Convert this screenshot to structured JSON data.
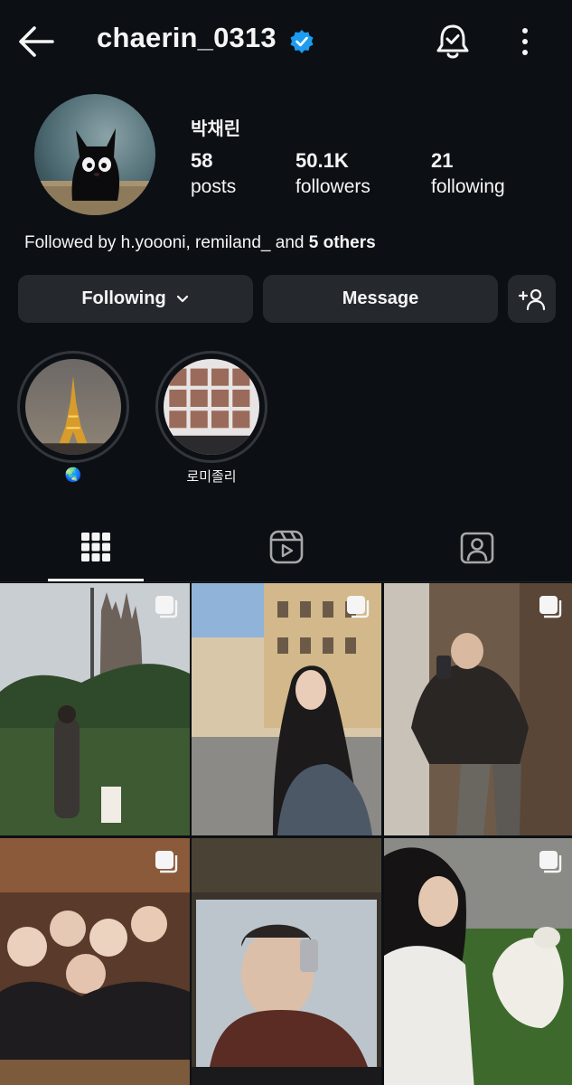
{
  "header": {
    "username": "chaerin_0313",
    "back_icon": "arrow-left-icon",
    "verified_icon": "verified-badge-icon",
    "notification_icon": "bell-check-icon",
    "more_icon": "more-vertical-icon",
    "verified_color": "#1d9bf0"
  },
  "profile": {
    "display_name": "박채린",
    "stats": [
      {
        "value": "58",
        "label": "posts"
      },
      {
        "value": "50.1K",
        "label": "followers"
      },
      {
        "value": "21",
        "label": "following"
      }
    ],
    "followed_by_prefix": "Followed by h.yoooni, remiland_ and ",
    "followed_by_bold": "5 others"
  },
  "actions": {
    "following_label": "Following",
    "message_label": "Message",
    "add_person_icon": "add-person-icon"
  },
  "highlights": [
    {
      "label": "🌏"
    },
    {
      "label": "로미졸리"
    }
  ],
  "tabs": [
    {
      "name": "posts",
      "icon": "grid-icon",
      "selected": true
    },
    {
      "name": "reels",
      "icon": "reels-icon",
      "selected": false
    },
    {
      "name": "tagged",
      "icon": "tagged-person-icon",
      "selected": false
    }
  ],
  "posts": [
    {
      "type": "carousel",
      "subject": "sagrada familia outdoor"
    },
    {
      "type": "carousel",
      "subject": "street portrait"
    },
    {
      "type": "carousel",
      "subject": "mirror selfie"
    },
    {
      "type": "carousel",
      "subject": "group photo"
    },
    {
      "type": "carousel",
      "subject": "laptop screen"
    },
    {
      "type": "carousel",
      "subject": "dog on grass"
    }
  ],
  "colors": {
    "background": "#0c1014",
    "button": "#25292e",
    "text": "#f5f5f5"
  }
}
